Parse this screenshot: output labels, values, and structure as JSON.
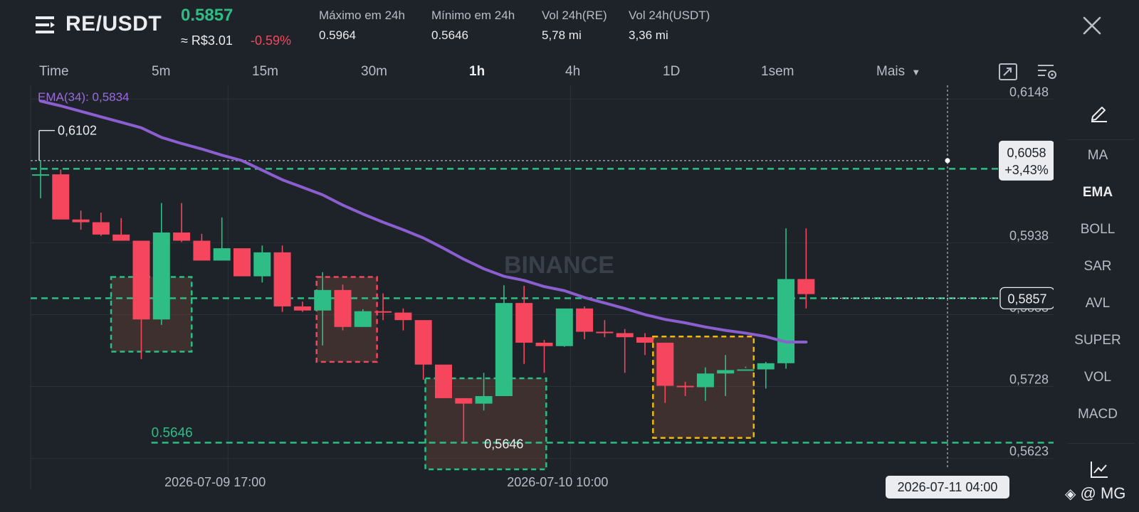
{
  "header": {
    "pair": "RE/USDT",
    "last_price": "0.5857",
    "price_brl": "≈ R$3.01",
    "change_pct": "-0.59%",
    "stats": [
      {
        "label": "Máximo em 24h",
        "value": "0.5964"
      },
      {
        "label": "Mínimo em 24h",
        "value": "0.5646"
      },
      {
        "label": "Vol 24h(RE)",
        "value": "5,78 mi"
      },
      {
        "label": "Vol 24h(USDT)",
        "value": "3,36 mi"
      }
    ]
  },
  "timeframes": {
    "items": [
      "Time",
      "5m",
      "15m",
      "30m",
      "1h",
      "4h",
      "1D",
      "1sem"
    ],
    "active": "1h",
    "more_label": "Mais"
  },
  "indicators": {
    "items": [
      "MA",
      "EMA",
      "BOLL",
      "SAR",
      "AVL",
      "SUPER",
      "VOL",
      "MACD"
    ],
    "active": "EMA"
  },
  "colors": {
    "background": "#1e2329",
    "up": "#2ebd85",
    "down": "#f6465d",
    "ema": "#8c5fd0",
    "highlight_yellow": "#f0b90b"
  },
  "chart_data": {
    "type": "candlestick",
    "ema_label": "EMA(34): 0,5834",
    "watermark": "BINANCE",
    "y_ticks": [
      "0,6148",
      "0,5938",
      "0,5833",
      "0,5728",
      "0,5623"
    ],
    "y_tick_values": [
      0.6148,
      0.5938,
      0.5833,
      0.5728,
      0.5623
    ],
    "x_labels": [
      {
        "label": "2026-07-09 17:00",
        "index": 9.3
      },
      {
        "label": "2026-07-10 10:00",
        "index": 26.3
      }
    ],
    "ylim": [
      0.5607,
      0.6168
    ],
    "candles": [
      {
        "o": 0.6036,
        "h": 0.6058,
        "l": 0.6003,
        "c": 0.6038
      },
      {
        "o": 0.6038,
        "h": 0.6045,
        "l": 0.598,
        "c": 0.5972
      },
      {
        "o": 0.5972,
        "h": 0.5985,
        "l": 0.5957,
        "c": 0.5968
      },
      {
        "o": 0.5968,
        "h": 0.5982,
        "l": 0.5948,
        "c": 0.595
      },
      {
        "o": 0.595,
        "h": 0.5974,
        "l": 0.5944,
        "c": 0.5941
      },
      {
        "o": 0.5941,
        "h": 0.594,
        "l": 0.5768,
        "c": 0.5826
      },
      {
        "o": 0.5826,
        "h": 0.5996,
        "l": 0.5818,
        "c": 0.5953
      },
      {
        "o": 0.5953,
        "h": 0.5996,
        "l": 0.5939,
        "c": 0.5941
      },
      {
        "o": 0.5941,
        "h": 0.5951,
        "l": 0.5915,
        "c": 0.5912
      },
      {
        "o": 0.5912,
        "h": 0.5975,
        "l": 0.5915,
        "c": 0.593
      },
      {
        "o": 0.593,
        "h": 0.5929,
        "l": 0.5891,
        "c": 0.5889
      },
      {
        "o": 0.5889,
        "h": 0.5934,
        "l": 0.588,
        "c": 0.5924
      },
      {
        "o": 0.5924,
        "h": 0.5934,
        "l": 0.5837,
        "c": 0.5845
      },
      {
        "o": 0.5845,
        "h": 0.5852,
        "l": 0.5837,
        "c": 0.5839
      },
      {
        "o": 0.5839,
        "h": 0.5895,
        "l": 0.5788,
        "c": 0.5869
      },
      {
        "o": 0.5869,
        "h": 0.5877,
        "l": 0.581,
        "c": 0.5815
      },
      {
        "o": 0.5815,
        "h": 0.5841,
        "l": 0.5828,
        "c": 0.5838
      },
      {
        "o": 0.5838,
        "h": 0.5864,
        "l": 0.5825,
        "c": 0.5836
      },
      {
        "o": 0.5836,
        "h": 0.5842,
        "l": 0.581,
        "c": 0.5825
      },
      {
        "o": 0.5825,
        "h": 0.5823,
        "l": 0.5738,
        "c": 0.576
      },
      {
        "o": 0.576,
        "h": 0.5755,
        "l": 0.5711,
        "c": 0.5711
      },
      {
        "o": 0.5711,
        "h": 0.5709,
        "l": 0.5646,
        "c": 0.5703
      },
      {
        "o": 0.5703,
        "h": 0.5748,
        "l": 0.5693,
        "c": 0.5714
      },
      {
        "o": 0.5714,
        "h": 0.5876,
        "l": 0.5715,
        "c": 0.585
      },
      {
        "o": 0.585,
        "h": 0.5875,
        "l": 0.5761,
        "c": 0.5792
      },
      {
        "o": 0.5792,
        "h": 0.5796,
        "l": 0.5748,
        "c": 0.5787
      },
      {
        "o": 0.5787,
        "h": 0.584,
        "l": 0.5786,
        "c": 0.5842
      },
      {
        "o": 0.5842,
        "h": 0.5845,
        "l": 0.5797,
        "c": 0.5808
      },
      {
        "o": 0.5808,
        "h": 0.5825,
        "l": 0.58,
        "c": 0.5806
      },
      {
        "o": 0.5806,
        "h": 0.5812,
        "l": 0.5748,
        "c": 0.58
      },
      {
        "o": 0.58,
        "h": 0.5806,
        "l": 0.5774,
        "c": 0.5792
      },
      {
        "o": 0.5792,
        "h": 0.5788,
        "l": 0.5704,
        "c": 0.5729
      },
      {
        "o": 0.5729,
        "h": 0.5735,
        "l": 0.5714,
        "c": 0.5727
      },
      {
        "o": 0.5727,
        "h": 0.5756,
        "l": 0.5707,
        "c": 0.5747
      },
      {
        "o": 0.5747,
        "h": 0.5774,
        "l": 0.5714,
        "c": 0.5752
      },
      {
        "o": 0.5752,
        "h": 0.5757,
        "l": 0.5755,
        "c": 0.5753
      },
      {
        "o": 0.5753,
        "h": 0.5764,
        "l": 0.5725,
        "c": 0.5762
      },
      {
        "o": 0.5762,
        "h": 0.5959,
        "l": 0.5754,
        "c": 0.5885
      },
      {
        "o": 0.5885,
        "h": 0.5959,
        "l": 0.5842,
        "c": 0.5863
      }
    ],
    "ema": [
      0.6145,
      0.6138,
      0.613,
      0.6122,
      0.6114,
      0.6106,
      0.6092,
      0.6083,
      0.6075,
      0.6066,
      0.6058,
      0.6044,
      0.603,
      0.6019,
      0.6008,
      0.5993,
      0.598,
      0.5968,
      0.5957,
      0.5945,
      0.593,
      0.5914,
      0.59,
      0.5889,
      0.5883,
      0.5874,
      0.5868,
      0.5858,
      0.585,
      0.5842,
      0.5833,
      0.5826,
      0.5821,
      0.5815,
      0.581,
      0.5806,
      0.5801,
      0.5793,
      0.5793
    ],
    "reference_lines": [
      {
        "value": 0.6046,
        "color": "#2ebd85",
        "dashed": true
      },
      {
        "value": 0.5857,
        "color": "#2ebd85",
        "dashed": true
      },
      {
        "value": 0.5646,
        "color": "#2ebd85",
        "dashed": true,
        "label": "0.5646"
      }
    ],
    "boxes": [
      {
        "from": 3.5,
        "to": 7.5,
        "top": 0.5888,
        "bottom": 0.5779,
        "color": "#2ebd85"
      },
      {
        "from": 13.7,
        "to": 16.7,
        "top": 0.5888,
        "bottom": 0.5764,
        "color": "#f6465d"
      },
      {
        "from": 19.1,
        "to": 25.1,
        "top": 0.574,
        "bottom": 0.5607,
        "color": "#2ebd85"
      },
      {
        "from": 30.4,
        "to": 35.4,
        "top": 0.5801,
        "bottom": 0.5653,
        "color": "#f0b90b"
      }
    ],
    "high_marker": {
      "index": 0,
      "value": 0.6102,
      "label": "0,6102"
    },
    "low_marker": {
      "index": 21,
      "value": 0.5646,
      "label": "0,5646"
    },
    "crosshair": {
      "index": 45,
      "value": 0.6058,
      "price_label": "0,6058",
      "pct_label": "+3,43%",
      "time_label": "2026-07-11 04:00"
    },
    "last_price_tag": "0,5857",
    "x_max_index": 49
  },
  "footer": {
    "watermark": "@ MG"
  }
}
